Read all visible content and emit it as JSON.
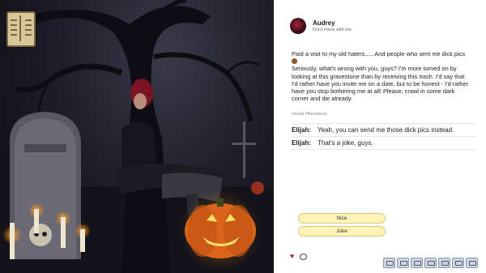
{
  "post": {
    "author": "Audrey",
    "status": "Don't mess with me",
    "text_part1": "Paid a visit to my old haters..... And people who sent me dick pics ",
    "text_part2": "\nSeriously, what's wrong with you, guys? I'm more turned on by looking at this gravestone than by receiving this trash. I'd say that I'd rather have you invite me on a date, but to be honest - I'd rather have you stop bothering me at all! Please, crawl in some dark corner and die already.",
    "tags": "#mood #fhereabout"
  },
  "comments": [
    {
      "author": "Elijah:",
      "text": "Yeah, you can send me those dick pics instead."
    },
    {
      "author": "Elijah:",
      "text": "That's a joke, guys."
    }
  ],
  "choices": [
    "Nice",
    "Joke"
  ],
  "toolbar_icons": [
    "gallery-icon",
    "phone-icon",
    "save-icon",
    "load-icon",
    "prefs-icon",
    "log-icon",
    "settings-icon"
  ],
  "colors": {
    "heart": "#cc1e2e",
    "choice_bg": "#fff3b8",
    "panel": "#ffffff"
  }
}
